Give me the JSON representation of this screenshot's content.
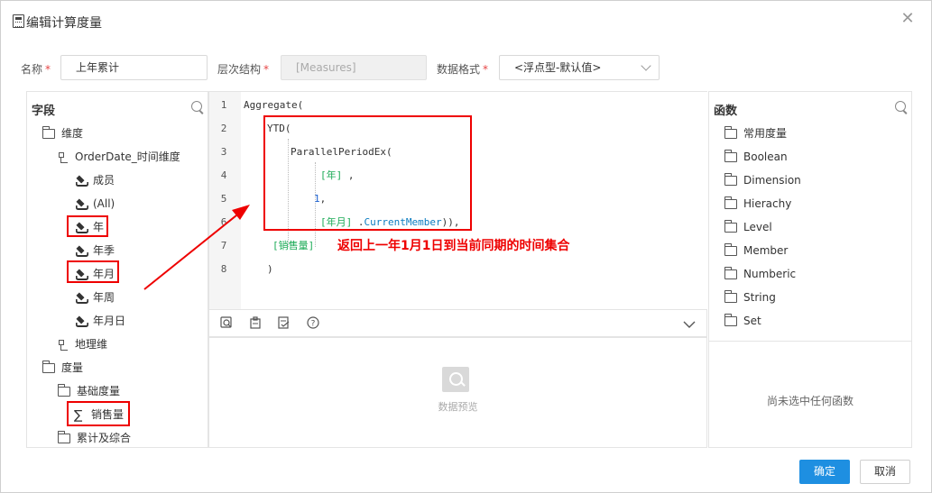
{
  "dialog": {
    "title": "编辑计算度量",
    "icons": {
      "title": "calculator-icon",
      "close": "close-icon"
    }
  },
  "form": {
    "name_label": "名称",
    "name_value": "上年累计",
    "hierarchy_label": "层次结构",
    "hierarchy_value": "[Measures]",
    "format_label": "数据格式",
    "format_value": "<浮点型-默认值>",
    "required_mark": "*"
  },
  "fields_panel": {
    "title": "字段",
    "items": [
      {
        "label": "维度",
        "icon": "folder-open-icon"
      },
      {
        "label": "OrderDate_时间维度",
        "icon": "hierarchy-icon"
      },
      {
        "label": "成员",
        "icon": "layers-icon"
      },
      {
        "label": "(All)",
        "icon": "layers-icon"
      },
      {
        "label": "年",
        "icon": "layers-icon"
      },
      {
        "label": "年季",
        "icon": "layers-icon"
      },
      {
        "label": "年月",
        "icon": "layers-icon"
      },
      {
        "label": "年周",
        "icon": "layers-icon"
      },
      {
        "label": "年月日",
        "icon": "layers-icon"
      },
      {
        "label": "地理维",
        "icon": "hierarchy-icon"
      },
      {
        "label": "度量",
        "icon": "folder-open-icon"
      },
      {
        "label": "基础度量",
        "icon": "folder-open-icon"
      },
      {
        "label": "销售量",
        "icon": "sigma-icon"
      },
      {
        "label": "累计及综合",
        "icon": "folder-open-icon"
      }
    ]
  },
  "editor": {
    "line_numbers": [
      "1",
      "2",
      "3",
      "4",
      "5",
      "6",
      "7",
      "8"
    ],
    "lines": {
      "l1": "Aggregate(",
      "l2": "YTD(",
      "l3": "ParallelPeriodEx(",
      "l4_member": "[年]",
      "l4_rest": " ,",
      "l5_num": "1",
      "l5_rest": ",",
      "l6_member": "[年月]",
      "l6_dot": " .",
      "l6_func": "CurrentMember",
      "l6_rest": ")),",
      "l7": "[销售量]",
      "l8": ")"
    },
    "annotation": "返回上一年1月1日到当前同期的时间集合",
    "colors": {
      "member": "#1aaa55",
      "number": "#1a5fd0",
      "function": "#0b7cc0",
      "annotation": "#e00000"
    }
  },
  "preview": {
    "label": "数据预览"
  },
  "functions_panel": {
    "title": "函数",
    "items": [
      "常用度量",
      "Boolean",
      "Dimension",
      "Hierachy",
      "Level",
      "Member",
      "Numberic",
      "String",
      "Set"
    ],
    "empty_text": "尚未选中任何函数"
  },
  "buttons": {
    "confirm": "确定",
    "cancel": "取消"
  },
  "accent_color": "#1e8fe1"
}
